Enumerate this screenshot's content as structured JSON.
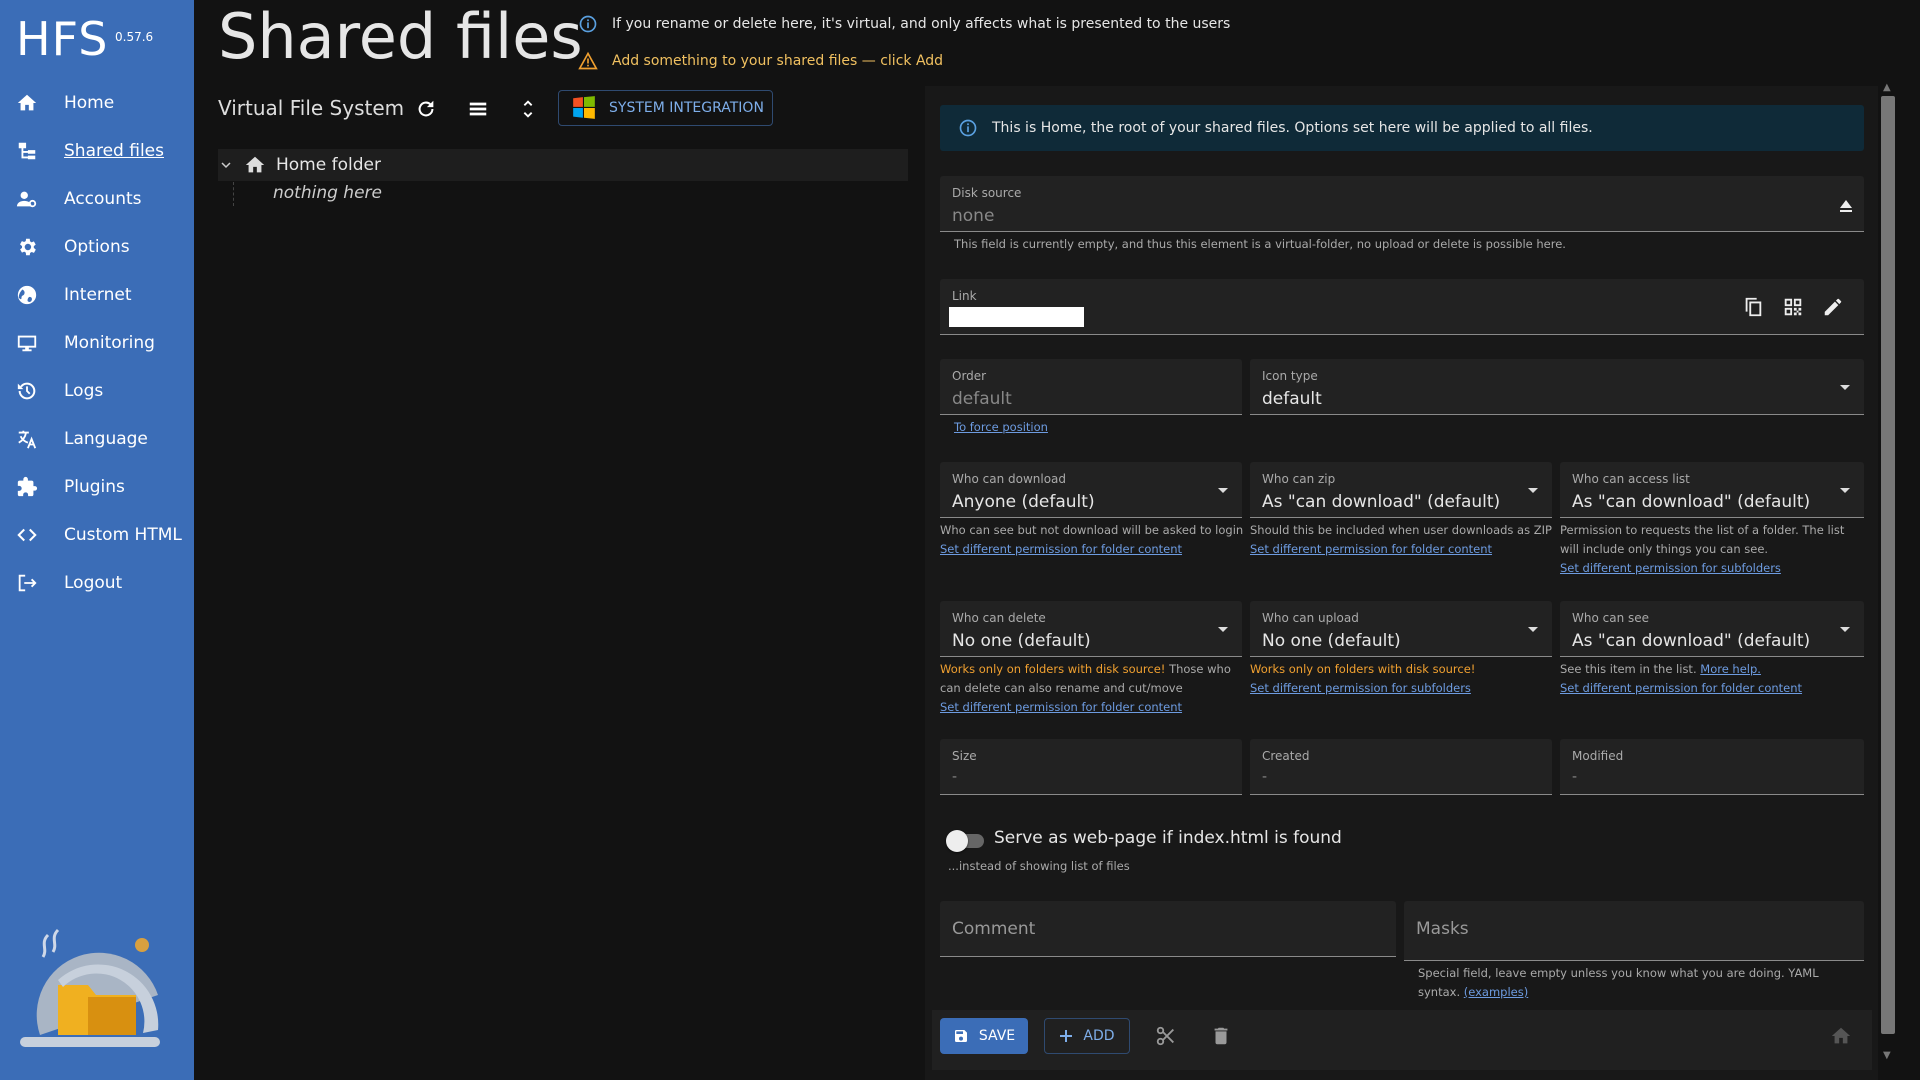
{
  "app": {
    "logo": "HFS",
    "version": "0.57.6"
  },
  "sidebar": {
    "items": [
      {
        "label": "Home",
        "icon": "home-icon"
      },
      {
        "label": "Shared files",
        "icon": "tree-icon",
        "active": true
      },
      {
        "label": "Accounts",
        "icon": "accounts-icon"
      },
      {
        "label": "Options",
        "icon": "gear-icon"
      },
      {
        "label": "Internet",
        "icon": "globe-icon"
      },
      {
        "label": "Monitoring",
        "icon": "monitor-icon"
      },
      {
        "label": "Logs",
        "icon": "history-icon"
      },
      {
        "label": "Language",
        "icon": "translate-icon"
      },
      {
        "label": "Plugins",
        "icon": "puzzle-icon"
      },
      {
        "label": "Custom HTML",
        "icon": "code-icon"
      },
      {
        "label": "Logout",
        "icon": "logout-icon"
      }
    ]
  },
  "header": {
    "title": "Shared files",
    "notice_info": "If you rename or delete here, it's virtual, and only affects what is presented to the users",
    "notice_warning": "Add something to your shared files — click Add"
  },
  "vfs": {
    "title": "Virtual File System",
    "system_integration_label": "SYSTEM INTEGRATION",
    "tree_root": "Home folder",
    "tree_empty": "nothing here"
  },
  "details": {
    "home_info": "This is Home, the root of your shared files. Options set here will be applied to all files.",
    "disk_source": {
      "label": "Disk source",
      "value": "none",
      "helper": "This field is currently empty, and thus this element is a virtual-folder, no upload or delete is possible here."
    },
    "link": {
      "label": "Link"
    },
    "order": {
      "label": "Order",
      "value": "default",
      "helper_link": "To force position"
    },
    "icon_type": {
      "label": "Icon type",
      "value": "default"
    },
    "who_can_download": {
      "label": "Who can download",
      "value": "Anyone (default)",
      "helper": "Who can see but not download will be asked to login",
      "helper_link": "Set different permission for folder content"
    },
    "who_can_zip": {
      "label": "Who can zip",
      "value": "As \"can download\" (default)",
      "helper": "Should this be included when user downloads as ZIP",
      "helper_link": "Set different permission for folder content"
    },
    "who_can_access_list": {
      "label": "Who can access list",
      "value": "As \"can download\" (default)",
      "helper": "Permission to requests the list of a folder. The list will include only things you can see.",
      "helper_link": "Set different permission for subfolders"
    },
    "who_can_delete": {
      "label": "Who can delete",
      "value": "No one (default)",
      "helper_warn": "Works only on folders with disk source!",
      "helper": " Those who can delete can also rename and cut/move",
      "helper_link": "Set different permission for folder content"
    },
    "who_can_upload": {
      "label": "Who can upload",
      "value": "No one (default)",
      "helper_warn": "Works only on folders with disk source!",
      "helper_link": "Set different permission for subfolders"
    },
    "who_can_see": {
      "label": "Who can see",
      "value": "As \"can download\" (default)",
      "helper": "See this item in the list. ",
      "helper_more": "More help.",
      "helper_link": "Set different permission for folder content"
    },
    "size": {
      "label": "Size",
      "value": "-"
    },
    "created": {
      "label": "Created",
      "value": "-"
    },
    "modified": {
      "label": "Modified",
      "value": "-"
    },
    "serve_webpage": {
      "label": "Serve as web-page if index.html is found",
      "helper": "...instead of showing list of files",
      "checked": false
    },
    "comment": {
      "placeholder": "Comment"
    },
    "masks": {
      "placeholder": "Masks",
      "helper": "Special field, leave empty unless you know what you are doing. YAML syntax. ",
      "helper_link": "(examples)"
    }
  },
  "actions": {
    "save_label": "SAVE",
    "add_label": "ADD"
  },
  "colors": {
    "sidebar": "#3b6db7",
    "background": "#121212",
    "accent_link": "#6d9be0",
    "warning": "#f0a030"
  }
}
